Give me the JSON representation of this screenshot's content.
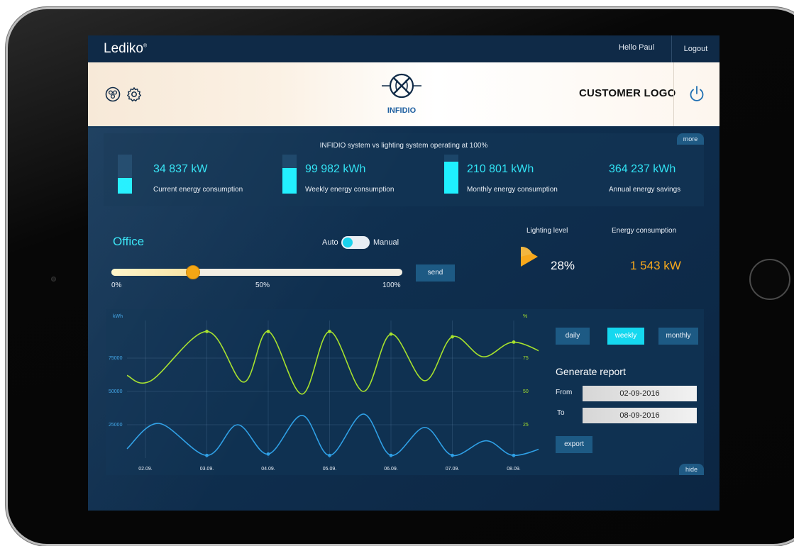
{
  "header": {
    "brand": "Lediko",
    "brand_mark": "®",
    "greeting": "Hello Paul",
    "logout_label": "Logout"
  },
  "banner": {
    "left_icons": [
      "connections-icon",
      "gear-icon"
    ],
    "product_name": "INFIDIO",
    "customer_logo": "CUSTOMER LOGO",
    "power_icon": "power-icon"
  },
  "stats": {
    "heading": "INFIDIO system vs lighting system operating at 100%",
    "more_label": "more",
    "items": [
      {
        "value": "34 837 kW",
        "label": "Current energy consumption",
        "level": 0.4
      },
      {
        "value": "99 982 kWh",
        "label": "Weekly energy consumption",
        "level": 0.65
      },
      {
        "value": "210 801 kWh",
        "label": "Monthly energy consumption",
        "level": 0.82
      },
      {
        "value": "364 237 kWh",
        "label": "Annual energy savings",
        "level": 0
      }
    ]
  },
  "control": {
    "zone": "Office",
    "auto_label": "Auto",
    "manual_label": "Manual",
    "slider_level": 28,
    "ticks": [
      "0%",
      "50%",
      "100%"
    ],
    "send_label": "send"
  },
  "readouts": {
    "lighting_heading": "Lighting level",
    "lighting_value": "28%",
    "energy_heading": "Energy consumption",
    "energy_value": "1 543 kW"
  },
  "chart_data": {
    "type": "line",
    "x": [
      "02.09.",
      "03.09.",
      "04.09.",
      "05.09.",
      "06.09.",
      "07.09.",
      "08.09."
    ],
    "y_left_unit": "kWh",
    "y_right_unit": "%",
    "y_left_ticks": [
      "75000",
      "50000",
      "25000"
    ],
    "y_right_ticks": [
      "75",
      "50",
      "25"
    ],
    "ylim_left": [
      0,
      100000
    ],
    "ylim_right": [
      0,
      100
    ],
    "grid": true,
    "series": [
      {
        "color": "#a6e12d",
        "axis": "right",
        "points": [
          [
            0,
            62
          ],
          [
            0.3,
            58
          ],
          [
            1,
            95
          ],
          [
            1.6,
            57
          ],
          [
            2,
            95
          ],
          [
            2.55,
            48
          ],
          [
            3,
            95
          ],
          [
            3.55,
            50
          ],
          [
            4,
            93
          ],
          [
            4.55,
            58
          ],
          [
            5,
            91
          ],
          [
            5.5,
            76
          ],
          [
            6,
            87
          ],
          [
            6.6,
            76
          ]
        ]
      },
      {
        "color": "#2fa0e6",
        "axis": "left",
        "points": [
          [
            0,
            7000
          ],
          [
            0.4,
            26000
          ],
          [
            1,
            2000
          ],
          [
            1.5,
            25000
          ],
          [
            2,
            3000
          ],
          [
            2.55,
            32000
          ],
          [
            3,
            2000
          ],
          [
            3.55,
            33000
          ],
          [
            4,
            2000
          ],
          [
            4.55,
            23000
          ],
          [
            5,
            2000
          ],
          [
            5.55,
            13000
          ],
          [
            6,
            2000
          ],
          [
            6.6,
            10000
          ]
        ]
      }
    ]
  },
  "report": {
    "periods": [
      "daily",
      "weekly",
      "monthly"
    ],
    "active_period": "weekly",
    "title": "Generate report",
    "from_label": "From",
    "from_value": "02-09-2016",
    "to_label": "To",
    "to_value": "08-09-2016",
    "export_label": "export",
    "hide_label": "hide"
  },
  "colors": {
    "accent_cyan": "#1ff0ff",
    "accent_orange": "#f7a81c",
    "series_green": "#a6e12d",
    "series_blue": "#2fa0e6",
    "panel_navy": "#0f2a47"
  }
}
